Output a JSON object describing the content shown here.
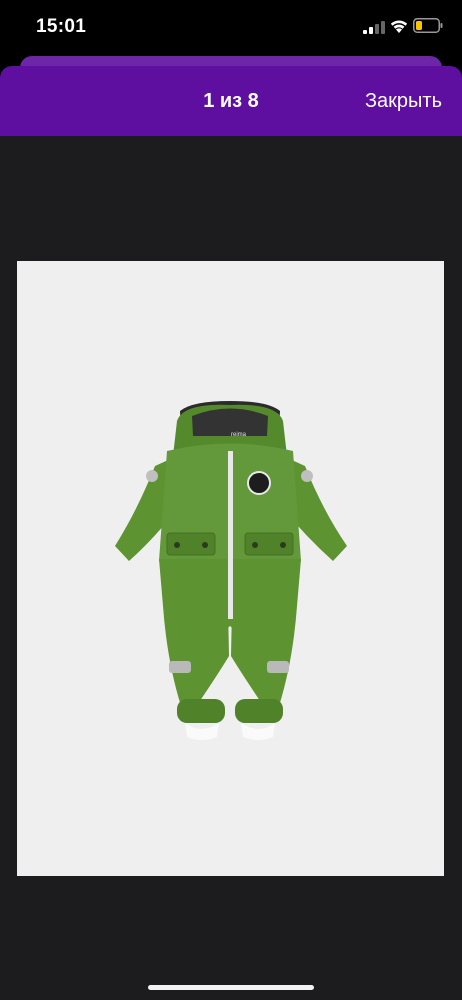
{
  "status_bar": {
    "time": "15:01",
    "icons": [
      "signal-icon",
      "wifi-icon",
      "battery-icon"
    ],
    "battery_color": "#f7c500"
  },
  "header": {
    "counter": "1 из 8",
    "close_label": "Закрыть",
    "background_color": "#5e0fa0"
  },
  "product_image": {
    "logo_text": "reima",
    "garment_color": "#5e9331"
  }
}
